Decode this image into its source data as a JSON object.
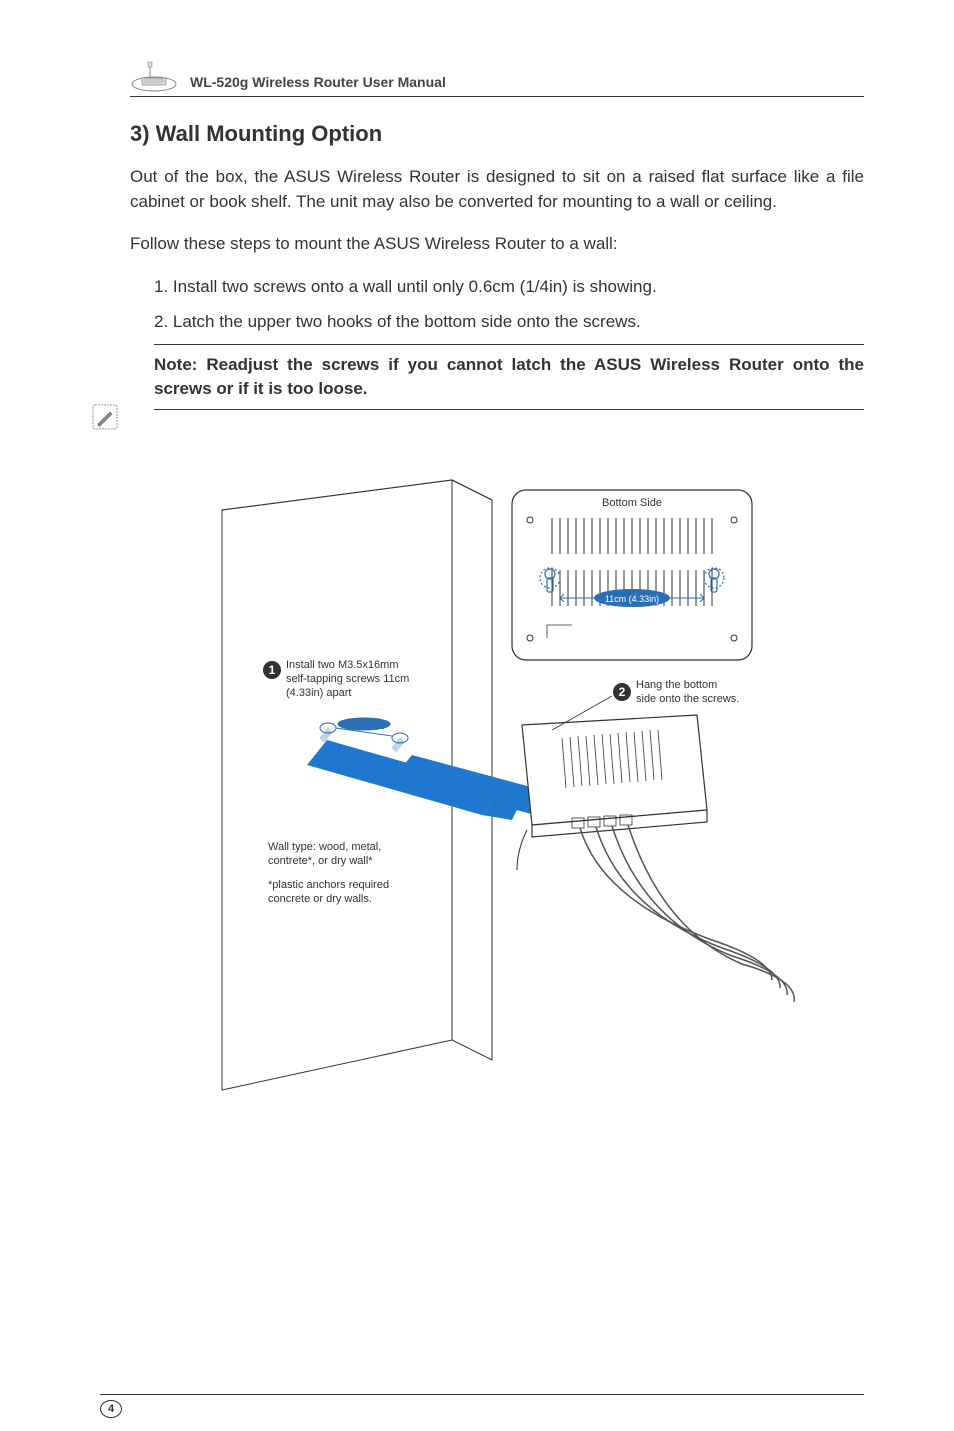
{
  "header": {
    "title": "WL-520g Wireless Router User Manual"
  },
  "section": {
    "heading": "3) Wall Mounting Option",
    "intro": "Out of the box, the ASUS Wireless Router is designed to sit on a raised flat surface like a file cabinet or book shelf. The unit may also be converted for mounting to a wall or ceiling.",
    "instruction": "Follow these steps to mount the ASUS Wireless Router to a wall:",
    "steps": {
      "s1": "1. Install two screws onto a wall until only 0.6cm (1/4in) is showing.",
      "s2": "2. Latch the upper two hooks of the bottom side onto the screws."
    },
    "note": "Note: Readjust the screws if you cannot latch the ASUS Wireless Router onto the screws or if it is too loose."
  },
  "diagram": {
    "bottom_side_label": "Bottom Side",
    "keyhole_distance": "11cm (4.33in)",
    "screw_distance_small": "11cm (4.33in)",
    "callout1": {
      "line1": "Install two M3.5x16mm",
      "line2": "self-tapping screws 11cm",
      "line3": "(4.33in) apart"
    },
    "callout2": {
      "line1": "Hang the bottom",
      "line2": "side onto the screws."
    },
    "wall_note": {
      "line1": "Wall type: wood, metal,",
      "line2": "contrete*, or dry wall*",
      "line3": "*plastic anchors required",
      "line4": "concrete or dry walls."
    }
  },
  "page_number": "4"
}
